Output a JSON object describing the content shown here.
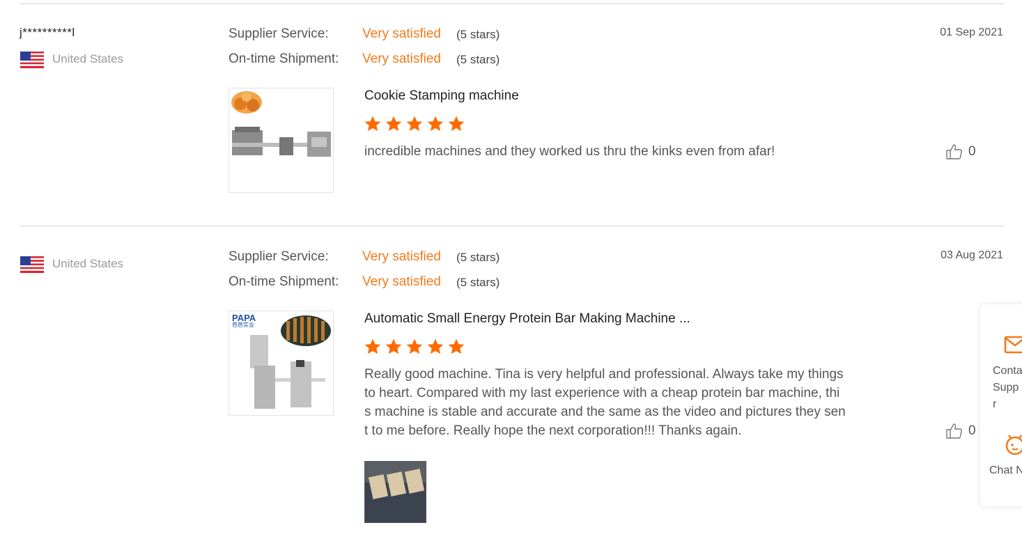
{
  "reviews": [
    {
      "user": "j**********l",
      "country": "United States",
      "date": "01 Sep 2021",
      "ratings": [
        {
          "label": "Supplier Service:",
          "value": "Very satisfied",
          "stars": "(5 stars)"
        },
        {
          "label": "On-time Shipment:",
          "value": "Very satisfied",
          "stars": "(5 stars)"
        }
      ],
      "product_title": "Cookie Stamping machine",
      "star_rating": 5,
      "text": "incredible machines and they worked us thru the kinks even from afar!",
      "likes": "0"
    },
    {
      "user": "",
      "country": "United States",
      "date": "03 Aug 2021",
      "ratings": [
        {
          "label": "Supplier Service:",
          "value": "Very satisfied",
          "stars": "(5 stars)"
        },
        {
          "label": "On-time Shipment:",
          "value": "Very satisfied",
          "stars": "(5 stars)"
        }
      ],
      "product_title": "Automatic Small Energy Protein Bar Making Machine ...",
      "product_logo": "PAPA",
      "product_logo_sub": "芭芭实业",
      "star_rating": 5,
      "text_lines": [
        "Really good machine. Tina is very helpful and professional. Always take my things",
        "to heart. Compared with my last experience with a cheap protein bar machine, thi",
        "s machine is stable and accurate and the same as the video and pictures they sen",
        "t to me before. Really hope the next corporation!!! Thanks again."
      ],
      "likes": "0"
    }
  ],
  "float": {
    "contact_lines": [
      "Conta",
      "Supp",
      "r"
    ],
    "chat_label": "Chat N",
    "contact_icon": "mail-icon",
    "chat_icon": "chat-icon"
  },
  "colors": {
    "accent": "#f27a1a",
    "star": "#ff6a00",
    "divider": "#d6d6d6"
  }
}
